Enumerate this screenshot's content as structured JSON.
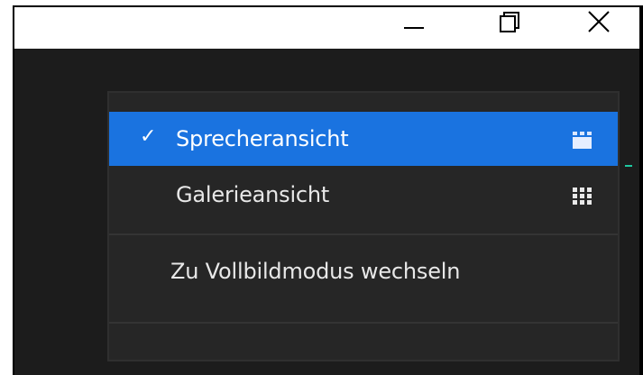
{
  "window": {
    "minimize_label": "Minimize",
    "maximize_label": "Restore",
    "close_label": "Close"
  },
  "menu": {
    "items": [
      {
        "label": "Sprecheransicht",
        "checked": true,
        "check_glyph": "✓",
        "icon": "speaker-view-icon"
      },
      {
        "label": "Galerieansicht",
        "checked": false,
        "icon": "gallery-grid-icon"
      }
    ],
    "fullscreen_label": "Zu Vollbildmodus wechseln"
  },
  "colors": {
    "selected_bg": "#1a73e0",
    "menu_bg": "#262626",
    "window_bg": "#1c1c1c"
  }
}
